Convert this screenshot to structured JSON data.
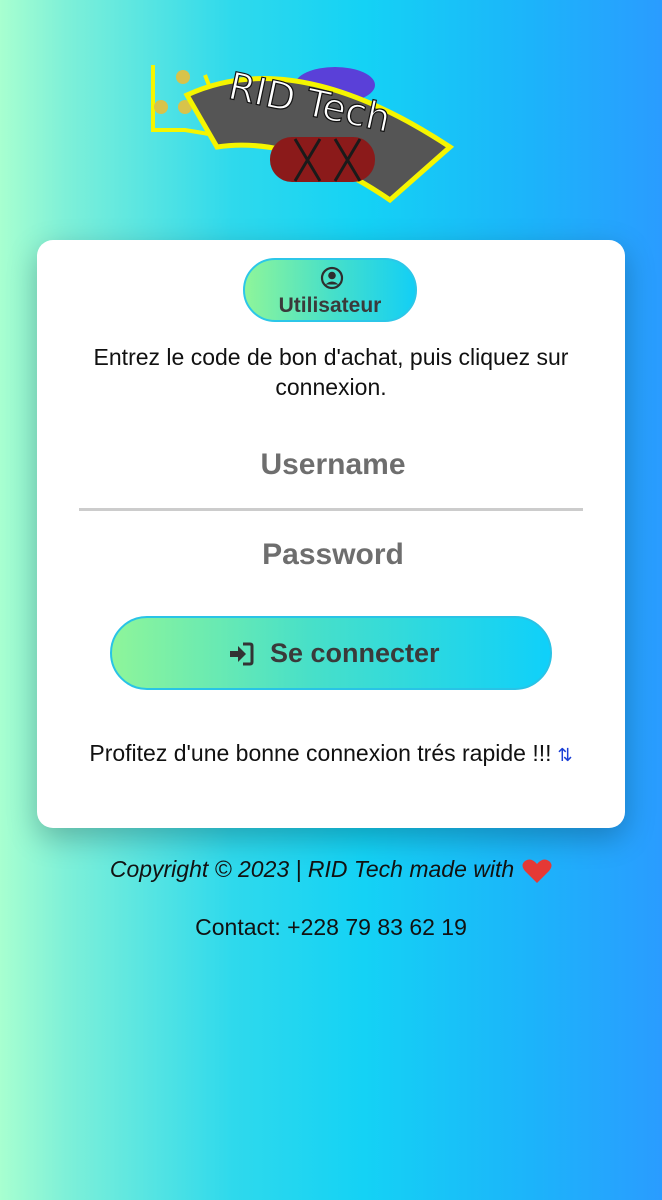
{
  "logo": {
    "text": "RID Tech",
    "colors": {
      "banner": "#555555",
      "outline": "#ffff00",
      "accent": "#8b1a1a"
    }
  },
  "card": {
    "user_button_label": "Utilisateur",
    "instruction": "Entrez le code de bon d'achat, puis cliquez sur connexion.",
    "username_placeholder": "Username",
    "password_placeholder": "Password",
    "login_button_label": "Se connecter",
    "promo_text": "Profitez d'une bonne connexion trés rapide !!!",
    "promo_icon": "⇅"
  },
  "footer": {
    "copyright": "Copyright © 2023 | RID Tech made with",
    "contact": "Contact: +228 79 83 62 19"
  },
  "icons": {
    "user": "user-circle-icon",
    "login": "sign-in-icon",
    "sort": "sort-arrows-icon",
    "heart": "heart-icon"
  },
  "theme": {
    "gradient_start": "#a8ffd0",
    "gradient_end": "#2a9cff",
    "button_gradient_start": "#8ef59a",
    "button_gradient_end": "#0fd0fa",
    "heart_color": "#e53935"
  }
}
